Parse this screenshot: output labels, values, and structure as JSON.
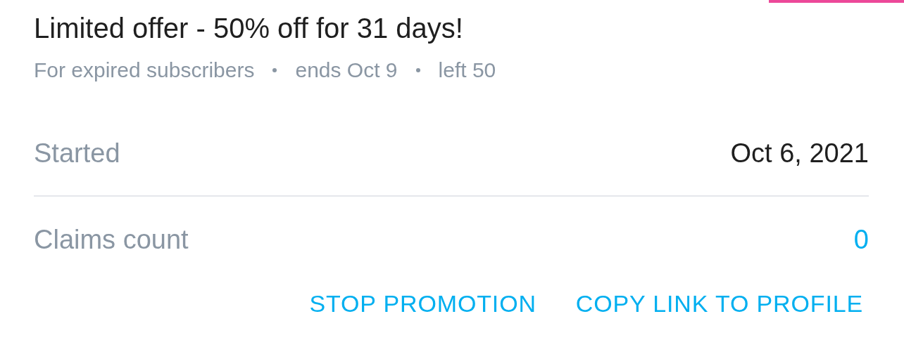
{
  "offer": {
    "title": "Limited offer - 50% off for 31 days!",
    "meta": [
      "For expired subscribers",
      "ends Oct 9",
      "left 50"
    ]
  },
  "details": [
    {
      "label": "Started",
      "value": "Oct 6, 2021",
      "kind": "plain"
    },
    {
      "label": "Claims count",
      "value": "0",
      "kind": "link"
    }
  ],
  "actions": [
    "STOP PROMOTION",
    "COPY LINK TO PROFILE"
  ]
}
